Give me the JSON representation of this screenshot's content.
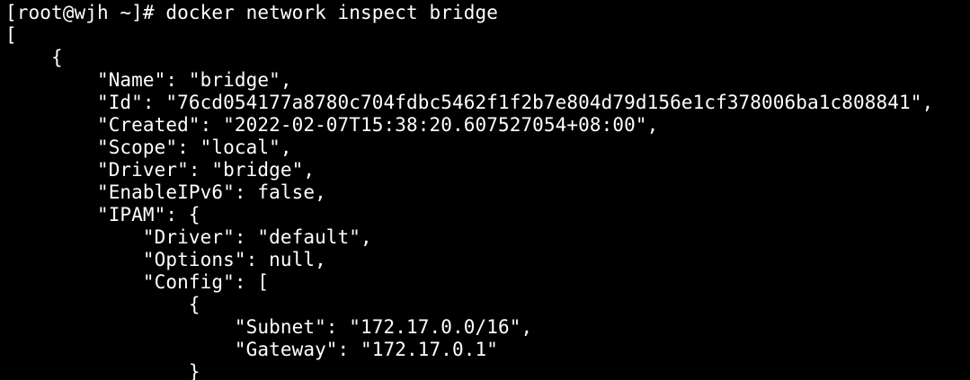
{
  "terminal": {
    "prompt": "[root@wjh ~]# ",
    "command": "docker network inspect bridge",
    "output": [
      "[",
      "    {",
      "        \"Name\": \"bridge\",",
      "        \"Id\": \"76cd054177a8780c704fdbc5462f1f2b7e804d79d156e1cf378006ba1c808841\",",
      "        \"Created\": \"2022-02-07T15:38:20.607527054+08:00\",",
      "        \"Scope\": \"local\",",
      "        \"Driver\": \"bridge\",",
      "        \"EnableIPv6\": false,",
      "        \"IPAM\": {",
      "            \"Driver\": \"default\",",
      "            \"Options\": null,",
      "            \"Config\": [",
      "                {",
      "                    \"Subnet\": \"172.17.0.0/16\",",
      "                    \"Gateway\": \"172.17.0.1\"",
      "                }"
    ],
    "colors": {
      "background": "#000000",
      "text": "#ffffff"
    }
  }
}
